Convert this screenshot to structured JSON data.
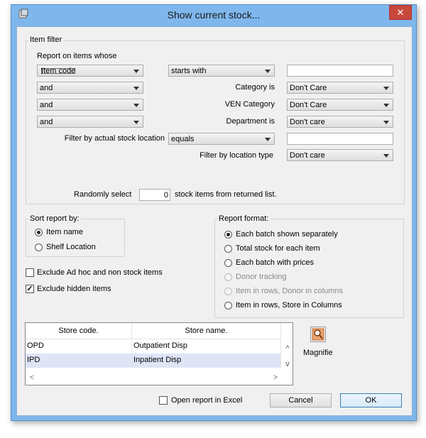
{
  "window": {
    "title": "Show current stock...",
    "close_glyph": "✕"
  },
  "item_filter": {
    "group_label": "Item filter",
    "report_on_label": "Report on items whose",
    "field_combo": "Item code",
    "op_combo": "starts with",
    "value": "",
    "and1": "and",
    "category_label": "Category is",
    "category_value": "Don't Care",
    "and2": "and",
    "ven_label": "VEN Category",
    "ven_value": "Don't Care",
    "and3": "and",
    "department_label": "Department is",
    "department_value": "Don't care",
    "location_label": "Filter by actual stock location",
    "location_op": "equals",
    "location_value": "",
    "location_type_label": "Filter by location type",
    "location_type_value": "Don't care",
    "random_prefix": "Randomly select",
    "random_value": "0",
    "random_suffix": "stock items from returned list."
  },
  "sort": {
    "group_label": "Sort report by:",
    "options": [
      "Item name",
      "Shelf Location"
    ],
    "selected": "Item name"
  },
  "checks": {
    "exclude_adhoc": "Exclude Ad hoc and non stock items",
    "exclude_adhoc_checked": false,
    "exclude_hidden": "Exclude hidden items",
    "exclude_hidden_checked": true,
    "check_glyph": "✓"
  },
  "format": {
    "group_label": "Report format:",
    "options": [
      "Each batch shown separately",
      "Total stock for each item",
      "Each batch with prices",
      "Donor tracking",
      "Item in rows, Donor in columns",
      "Item in rows, Store in Columns"
    ],
    "selected": "Each batch shown separately",
    "disabled": [
      "Donor tracking",
      "Item in rows, Donor in columns"
    ]
  },
  "stores": {
    "columns": [
      "Store code.",
      "Store name."
    ],
    "rows": [
      {
        "code": "OPD",
        "name": "Outpatient Disp"
      },
      {
        "code": "IPD",
        "name": "Inpatient Disp"
      }
    ],
    "selected_row": 1,
    "scroll_up": "^",
    "scroll_down": "v",
    "scroll_left": "<",
    "scroll_right": ">"
  },
  "magnifie_label": "Magnifie",
  "footer": {
    "excel_label": "Open report in Excel",
    "excel_checked": false,
    "cancel": "Cancel",
    "ok": "OK"
  },
  "colors": {
    "titlebar": "#7fb7ec",
    "close": "#c9483c",
    "selection": "#dfe5f7"
  }
}
